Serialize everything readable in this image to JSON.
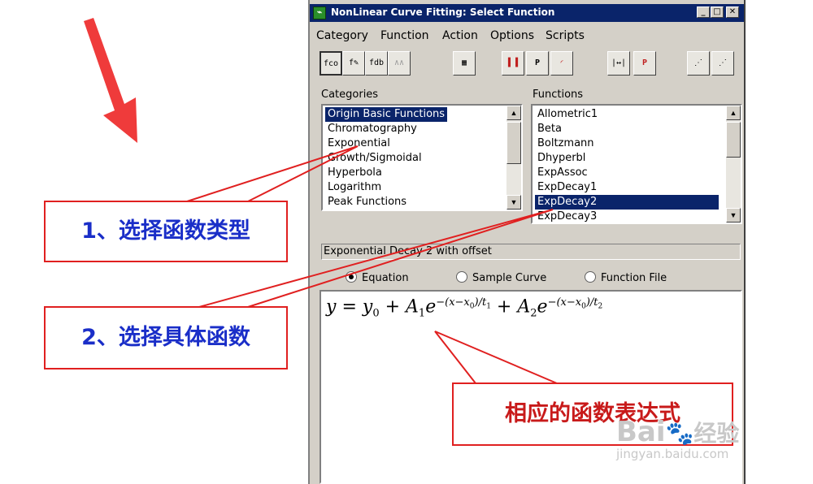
{
  "window": {
    "title": "NonLinear Curve Fitting:  Select Function",
    "icon": "origin-app-icon",
    "caption_buttons": [
      "minimize",
      "maximize",
      "close"
    ]
  },
  "menu": [
    "Category",
    "Function",
    "Action",
    "Options",
    "Scripts"
  ],
  "toolbar": [
    {
      "icon": "fx-check-icon",
      "glyph": "fco"
    },
    {
      "icon": "fx-edit-icon",
      "glyph": "f✎"
    },
    {
      "icon": "fx-new-icon",
      "glyph": "fdb"
    },
    {
      "icon": "peak-disabled-icon",
      "glyph": "∧∧"
    },
    {
      "icon": "worksheet-icon",
      "glyph": "▦"
    },
    {
      "icon": "data-bars-icon",
      "glyph": "▌▐"
    },
    {
      "icon": "parameters-icon",
      "glyph": "P"
    },
    {
      "icon": "curve-fit-icon",
      "glyph": "◜"
    },
    {
      "icon": "fit-range-icon",
      "glyph": "|↔|"
    },
    {
      "icon": "param-edit-icon",
      "glyph": "P"
    },
    {
      "icon": "iterate-once-icon",
      "glyph": "⋰"
    },
    {
      "icon": "iterate-icon",
      "glyph": "⋰"
    }
  ],
  "categories": {
    "label": "Categories",
    "items": [
      "Origin Basic Functions",
      "Chromatography",
      "Exponential",
      "Growth/Sigmoidal",
      "Hyperbola",
      "Logarithm",
      "Peak Functions"
    ],
    "selected_index": 0
  },
  "functions": {
    "label": "Functions",
    "items": [
      "Allometric1",
      "Beta",
      "Boltzmann",
      "Dhyperbl",
      "ExpAssoc",
      "ExpDecay1",
      "ExpDecay2",
      "ExpDecay3"
    ],
    "selected_index": 6
  },
  "description": "Exponential Decay 2 with offset",
  "view_options": [
    {
      "label": "Equation",
      "checked": true
    },
    {
      "label": "Sample Curve",
      "checked": false
    },
    {
      "label": "Function File",
      "checked": false
    }
  ],
  "equation": {
    "y": "y",
    "eq": "=",
    "y0": "y",
    "y0_sub": "0",
    "plus1": "+",
    "A1": "A",
    "A1_sub": "1",
    "e1": "e",
    "exp1": "−(x−x",
    "exp1_sub": "0",
    "exp1_end": ")/t",
    "exp1_end_sub": "1",
    "plus2": "+",
    "A2": "A",
    "A2_sub": "2",
    "e2": "e",
    "exp2": "−(x−x",
    "exp2_sub": "0",
    "exp2_end": ")/t",
    "exp2_end_sub": "2"
  },
  "annotations": {
    "step1": "1、选择函数类型",
    "step2": "2、选择具体函数",
    "expression": "相应的函数表达式",
    "arrow_color": "#ef3b3b",
    "line_color": "#e02020"
  },
  "watermark": {
    "brand": "Bai",
    "brand2": "经验",
    "site": "jingyan.baidu.com"
  }
}
